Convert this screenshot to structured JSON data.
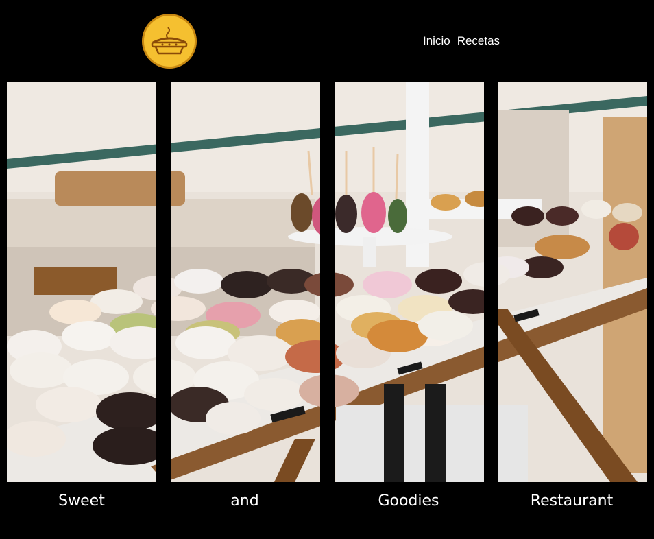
{
  "nav": {
    "items": [
      "Inicio",
      "Recetas"
    ]
  },
  "captions": [
    "Sweet",
    "and",
    "Goodies",
    "Restaurant"
  ],
  "colors": {
    "background": "#000000",
    "logo_fill": "#f5c030",
    "logo_stroke": "#c88812",
    "text": "#ffffff"
  },
  "logo": {
    "icon": "pie-icon"
  }
}
